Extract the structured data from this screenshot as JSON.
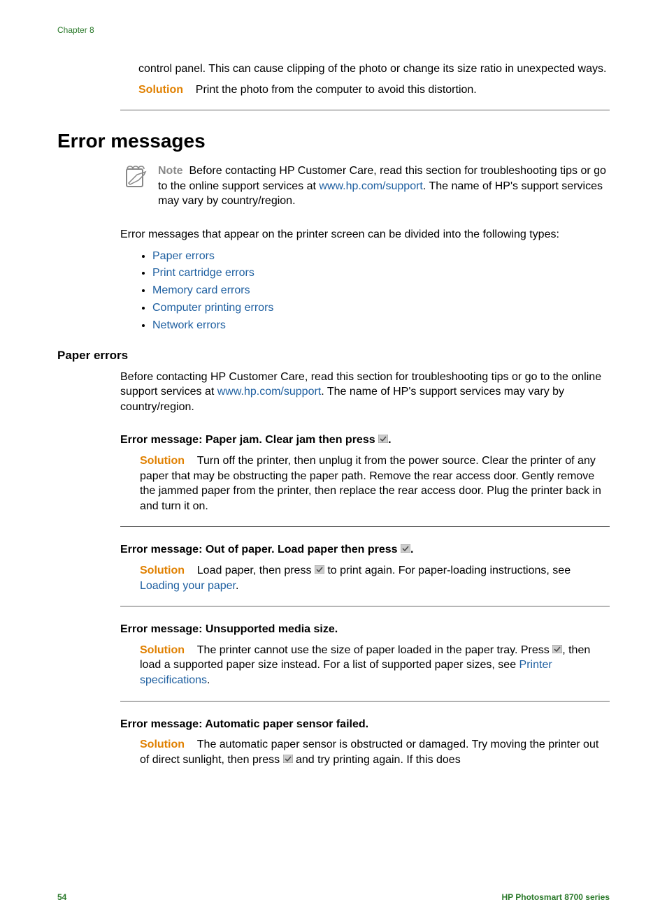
{
  "chapter_label": "Chapter 8",
  "intro_paragraph": "control panel. This can cause clipping of the photo or change its size ratio in unexpected ways.",
  "intro_solution": {
    "label": "Solution",
    "text": "Print the photo from the computer to avoid this distortion."
  },
  "heading": "Error messages",
  "note": {
    "label": "Note",
    "text_before_link": "Before contacting HP Customer Care, read this section for troubleshooting tips or go to the online support services at ",
    "link": "www.hp.com/support",
    "text_after_link": ". The name of HP's support services may vary by country/region."
  },
  "body_intro": "Error messages that appear on the printer screen can be divided into the following types:",
  "error_types": [
    "Paper errors",
    "Print cartridge errors",
    "Memory card errors",
    "Computer printing errors",
    "Network errors"
  ],
  "paper_errors": {
    "heading": "Paper errors",
    "intro_before_link": "Before contacting HP Customer Care, read this section for troubleshooting tips or go to the online support services at ",
    "intro_link": "www.hp.com/support",
    "intro_after_link": ". The name of HP's support services may vary by country/region.",
    "errors": [
      {
        "title_prefix": "Error message: Paper jam. Clear jam then press ",
        "title_has_icon": true,
        "title_suffix": ".",
        "solution_label": "Solution",
        "solution_text": "Turn off the printer, then unplug it from the power source. Clear the printer of any paper that may be obstructing the paper path. Remove the rear access door. Gently remove the jammed paper from the printer, then replace the rear access door. Plug the printer back in and turn it on.",
        "links": []
      },
      {
        "title_prefix": "Error message: Out of paper. Load paper then press ",
        "title_has_icon": true,
        "title_suffix": ".",
        "solution_label": "Solution",
        "solution_parts": {
          "t1": "Load paper, then press ",
          "t2": " to print again. For paper-loading instructions, see ",
          "link": "Loading your paper",
          "t3": "."
        }
      },
      {
        "title_prefix": "Error message: Unsupported media size.",
        "title_has_icon": false,
        "title_suffix": "",
        "solution_label": "Solution",
        "solution_parts": {
          "t1": "The printer cannot use the size of paper loaded in the paper tray. Press ",
          "t2": ", then load a supported paper size instead. For a list of supported paper sizes, see ",
          "link": "Printer specifications",
          "t3": "."
        }
      },
      {
        "title_prefix": "Error message: Automatic paper sensor failed.",
        "title_has_icon": false,
        "title_suffix": "",
        "solution_label": "Solution",
        "solution_parts": {
          "t1": "The automatic paper sensor is obstructed or damaged. Try moving the printer out of direct sunlight, then press ",
          "t2": " and try printing again. If this does"
        }
      }
    ]
  },
  "footer": {
    "page": "54",
    "product": "HP Photosmart 8700 series"
  }
}
